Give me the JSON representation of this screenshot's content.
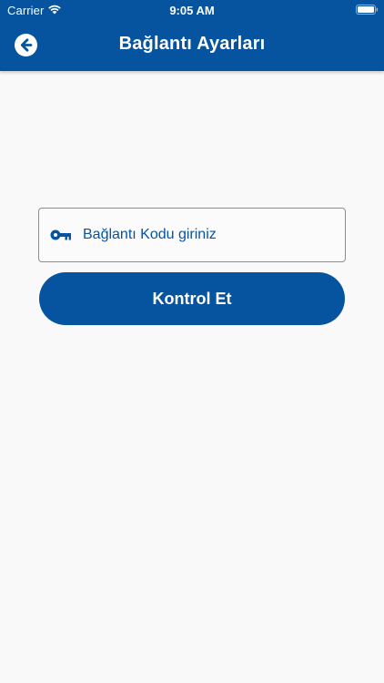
{
  "status_bar": {
    "carrier": "Carrier",
    "time": "9:05 AM",
    "wifi_icon": "wifi-icon",
    "battery_icon": "battery-icon"
  },
  "header": {
    "title": "Bağlantı Ayarları",
    "back_icon": "arrow-left-circle-icon"
  },
  "form": {
    "code_field": {
      "placeholder": "Bağlantı Kodu giriniz",
      "value": "",
      "icon": "key-icon"
    },
    "submit_label": "Kontrol Et"
  },
  "colors": {
    "primary": "#0654a0",
    "background": "#f9f9f9",
    "field_border": "#8e8e8e",
    "text_on_primary": "#ffffff"
  }
}
